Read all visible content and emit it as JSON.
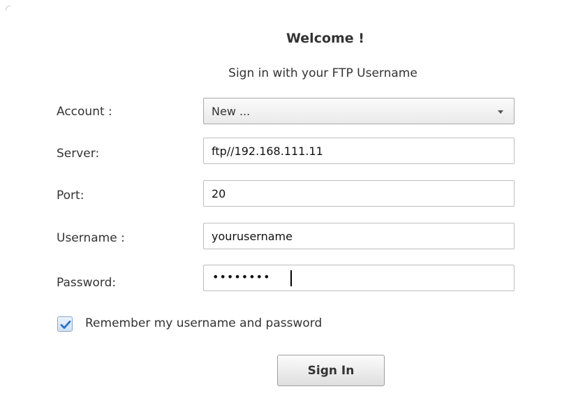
{
  "header": {
    "title": "Welcome !",
    "subtitle": "Sign in with your FTP Username"
  },
  "form": {
    "account": {
      "label": "Account :",
      "selected": "New ..."
    },
    "server": {
      "label": "Server:",
      "value": "ftp//192.168.111.11"
    },
    "port": {
      "label": "Port:",
      "value": "20"
    },
    "username": {
      "label": "Username :",
      "value": "yourusername"
    },
    "password": {
      "label": "Password:",
      "masked_value": "••••••••"
    },
    "remember": {
      "label": "Remember my username and password",
      "checked": true
    },
    "submit_label": "Sign In"
  },
  "icons": {
    "dropdown": "chevron-down-icon",
    "checkmark": "checkmark-icon"
  },
  "colors": {
    "checkmark": "#2a6fc9",
    "text": "#333333",
    "field_border": "#bdbdbd"
  }
}
